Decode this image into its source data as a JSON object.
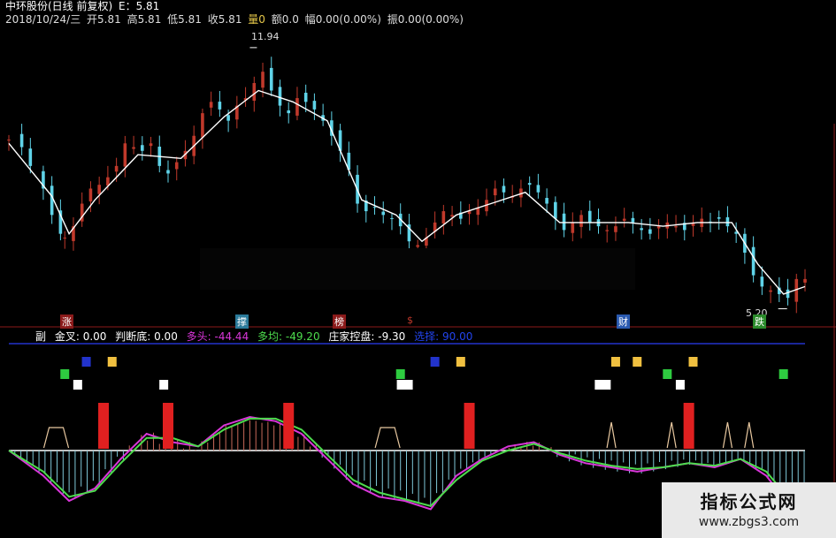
{
  "header": {
    "stock": "中环股份(日线 前复权)",
    "field_ma": "E：5.81",
    "date": "2018/10/24/三",
    "open": "开5.81",
    "high": "高5.81",
    "low": "低5.81",
    "close": "收5.81",
    "volume": "量0",
    "amount": "额0.0",
    "change": "幅0.00(0.00%)",
    "amplitude": "振0.00(0.00%)"
  },
  "labels": {
    "max_price": "11.94",
    "min_price": "5.20"
  },
  "event_tags": [
    {
      "text": "涨",
      "color": "#8b1a1a"
    },
    {
      "text": "撑",
      "color": "#2a7a9a"
    },
    {
      "text": "榜",
      "color": "#8b1a1a"
    },
    {
      "text": "$",
      "color": "#8b1a1a"
    },
    {
      "text": "财",
      "color": "#2a5ab0"
    },
    {
      "text": "跌",
      "color": "#2a8a2a"
    }
  ],
  "indicator": {
    "name": "副",
    "jincha": "金叉: 0.00",
    "panduandi": "判断底: 0.00",
    "duotou": "多头: -44.44",
    "duojun": "多均: -49.20",
    "zhuangjia": "庄家控盘: -9.30",
    "xuanze": "选择: 90.00"
  },
  "watermark": {
    "title": "指标公式网",
    "url": "www.zbgs3.com"
  },
  "colors": {
    "up": "#c0392b",
    "down": "#5fd3e8",
    "ma_white": "#ffffff",
    "duotou_line": "#d936d9",
    "duojun_line": "#4ddb4d",
    "blue_line": "#2233cc",
    "red_border": "#8b1a1a"
  },
  "chart_data": [
    {
      "type": "candlestick",
      "close_points": [
        [
          0,
          9.5
        ],
        [
          3,
          9.3
        ],
        [
          5,
          8.8
        ],
        [
          8,
          8.2
        ],
        [
          10,
          7.5
        ],
        [
          12,
          7.0
        ],
        [
          13,
          6.9
        ],
        [
          15,
          7.2
        ],
        [
          17,
          7.8
        ],
        [
          19,
          8.2
        ],
        [
          21,
          8.3
        ],
        [
          23,
          8.5
        ],
        [
          25,
          8.8
        ],
        [
          27,
          9.4
        ],
        [
          29,
          9.3
        ],
        [
          31,
          9.2
        ],
        [
          33,
          9.4
        ],
        [
          35,
          8.8
        ],
        [
          37,
          8.6
        ],
        [
          39,
          8.9
        ],
        [
          41,
          9.2
        ],
        [
          43,
          9.6
        ],
        [
          45,
          10.2
        ],
        [
          47,
          10.5
        ],
        [
          49,
          10.3
        ],
        [
          51,
          10.0
        ],
        [
          53,
          10.4
        ],
        [
          55,
          10.6
        ],
        [
          57,
          11.0
        ],
        [
          59,
          11.3
        ],
        [
          61,
          10.8
        ],
        [
          63,
          10.4
        ],
        [
          65,
          10.2
        ],
        [
          67,
          10.6
        ],
        [
          69,
          10.5
        ],
        [
          71,
          10.3
        ],
        [
          73,
          10.0
        ],
        [
          75,
          9.6
        ],
        [
          77,
          9.2
        ],
        [
          79,
          8.7
        ],
        [
          81,
          7.8
        ],
        [
          83,
          7.6
        ],
        [
          85,
          7.7
        ],
        [
          87,
          7.5
        ],
        [
          89,
          7.4
        ],
        [
          91,
          7.2
        ],
        [
          93,
          6.8
        ],
        [
          95,
          6.7
        ],
        [
          97,
          6.9
        ],
        [
          99,
          7.3
        ],
        [
          101,
          7.6
        ],
        [
          103,
          7.5
        ],
        [
          105,
          7.4
        ],
        [
          107,
          7.6
        ],
        [
          109,
          7.7
        ],
        [
          111,
          7.9
        ],
        [
          113,
          8.2
        ],
        [
          115,
          8.1
        ],
        [
          117,
          8.0
        ],
        [
          119,
          8.2
        ],
        [
          121,
          8.3
        ],
        [
          123,
          8.1
        ],
        [
          125,
          7.8
        ],
        [
          127,
          7.4
        ],
        [
          129,
          7.1
        ],
        [
          131,
          7.3
        ],
        [
          133,
          7.5
        ],
        [
          135,
          7.3
        ],
        [
          137,
          7.2
        ],
        [
          139,
          7.1
        ],
        [
          141,
          7.2
        ],
        [
          143,
          7.4
        ],
        [
          145,
          7.3
        ],
        [
          147,
          7.1
        ],
        [
          149,
          7.0
        ],
        [
          151,
          7.2
        ],
        [
          153,
          7.3
        ],
        [
          155,
          7.2
        ],
        [
          157,
          7.1
        ],
        [
          159,
          7.3
        ],
        [
          161,
          7.4
        ],
        [
          163,
          7.3
        ],
        [
          165,
          7.4
        ],
        [
          167,
          7.2
        ],
        [
          169,
          7.0
        ],
        [
          171,
          6.5
        ],
        [
          173,
          5.9
        ],
        [
          175,
          5.6
        ],
        [
          177,
          5.5
        ],
        [
          179,
          5.4
        ],
        [
          181,
          5.3
        ],
        [
          183,
          5.8
        ],
        [
          185,
          5.8
        ]
      ],
      "ma_points": [
        [
          0,
          9.4
        ],
        [
          10,
          8.0
        ],
        [
          14,
          7.0
        ],
        [
          20,
          7.9
        ],
        [
          30,
          9.1
        ],
        [
          40,
          9.0
        ],
        [
          50,
          10.1
        ],
        [
          58,
          10.8
        ],
        [
          66,
          10.5
        ],
        [
          74,
          10.0
        ],
        [
          82,
          7.9
        ],
        [
          90,
          7.5
        ],
        [
          96,
          6.8
        ],
        [
          104,
          7.5
        ],
        [
          112,
          7.8
        ],
        [
          120,
          8.1
        ],
        [
          128,
          7.3
        ],
        [
          136,
          7.3
        ],
        [
          144,
          7.3
        ],
        [
          152,
          7.2
        ],
        [
          160,
          7.3
        ],
        [
          168,
          7.3
        ],
        [
          174,
          6.2
        ],
        [
          180,
          5.4
        ],
        [
          185,
          5.6
        ]
      ],
      "ylim": [
        5.0,
        12.5
      ],
      "annotations": [
        {
          "text": "11.94",
          "x": 56,
          "y": 11.94
        },
        {
          "text": "5.20",
          "x": 180,
          "y": 5.2
        }
      ]
    },
    {
      "type": "line",
      "series": [
        {
          "name": "多头",
          "color": "#d936d9"
        },
        {
          "name": "多均",
          "color": "#4ddb4d"
        }
      ],
      "x": [
        0,
        8,
        14,
        20,
        26,
        32,
        38,
        44,
        50,
        56,
        62,
        68,
        74,
        80,
        86,
        92,
        98,
        104,
        110,
        116,
        122,
        128,
        134,
        140,
        146,
        152,
        158,
        164,
        170,
        176,
        185
      ],
      "duotou": [
        0,
        -30,
        -60,
        -45,
        -10,
        20,
        10,
        5,
        30,
        40,
        35,
        20,
        -10,
        -40,
        -55,
        -60,
        -70,
        -30,
        -10,
        5,
        10,
        -5,
        -15,
        -20,
        -25,
        -20,
        -15,
        -20,
        -10,
        -30,
        -90
      ],
      "duojun": [
        0,
        -25,
        -55,
        -48,
        -15,
        15,
        15,
        5,
        25,
        38,
        38,
        25,
        -5,
        -35,
        -50,
        -58,
        -66,
        -35,
        -12,
        0,
        8,
        -3,
        -12,
        -18,
        -22,
        -20,
        -15,
        -18,
        -10,
        -25,
        -80
      ],
      "ylim": [
        -100,
        100
      ]
    }
  ]
}
